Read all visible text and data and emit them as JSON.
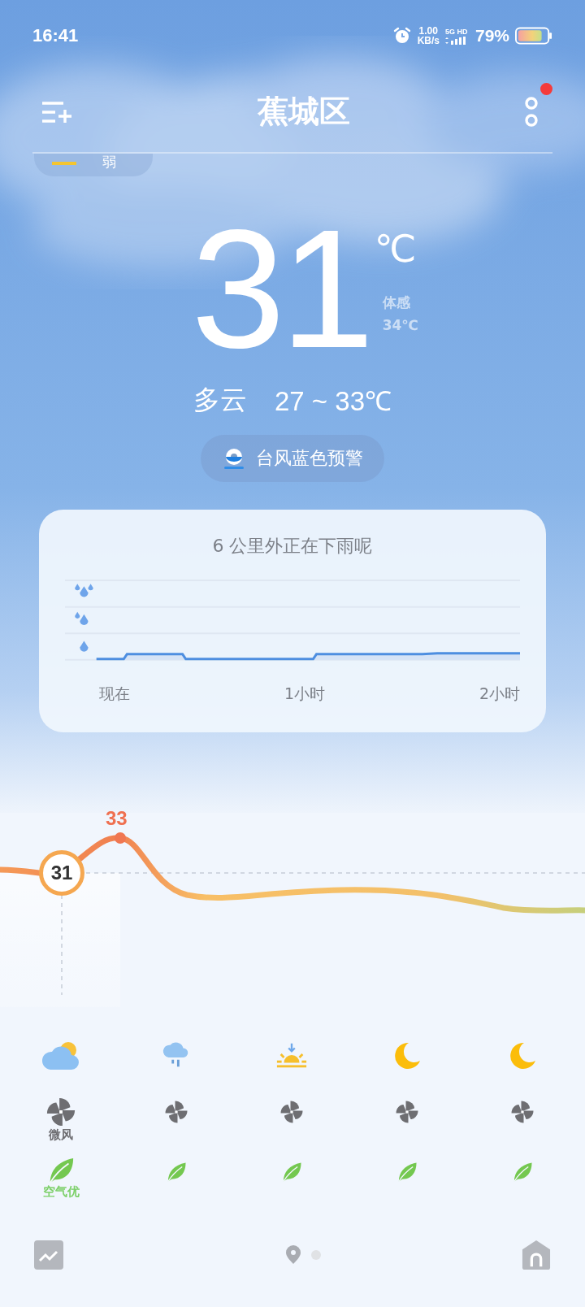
{
  "status_bar": {
    "time": "16:41",
    "net_speed": "1.00",
    "net_unit": "KB/s",
    "network": "5G",
    "hd": "HD",
    "battery": "79%"
  },
  "header": {
    "title": "蕉城区",
    "notification_dot": true
  },
  "uv_pill": {
    "value": "弱"
  },
  "current": {
    "temperature": "31",
    "unit": "℃",
    "feels_label": "体感",
    "feels_value": "34℃",
    "condition": "多云",
    "range": "27 ~ 33℃"
  },
  "alert": {
    "text": "台风蓝色预警"
  },
  "rain_card": {
    "title": "6 公里外正在下雨呢",
    "time_labels": [
      "现在",
      "1小时",
      "2小时"
    ]
  },
  "temp_curve": {
    "current": "31",
    "peak": "33"
  },
  "hours": [
    {
      "kind": "cloudy_sun",
      "wind": "微风",
      "air": "空气优"
    },
    {
      "kind": "rain"
    },
    {
      "kind": "sunset"
    },
    {
      "kind": "moon"
    },
    {
      "kind": "moon"
    }
  ],
  "pager": [
    {
      "kind": "location",
      "selected": true
    },
    {
      "kind": "dot",
      "selected": false
    }
  ]
}
